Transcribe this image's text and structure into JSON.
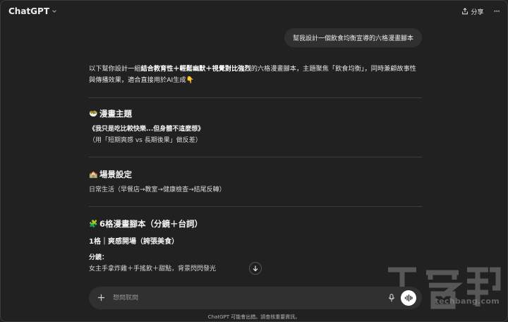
{
  "header": {
    "app_title": "ChatGPT",
    "share_label": "分享",
    "more_label": "···"
  },
  "user_message": "幫我設計一個飲食均衡宣導的六格漫畫腳本",
  "assistant": {
    "intro_1": "以下幫你設計一組",
    "intro_bold": "結合教育性＋輕鬆幽默＋視覺對比強烈",
    "intro_2": "的六格漫畫腳本，主題聚焦「飲食均衡」，同時兼顧故事性與傳播效果，適合直接用於AI生成",
    "intro_emoji": "👇",
    "sections": [
      {
        "emoji": "🥗",
        "title": "漫畫主題",
        "lines": [
          "《我只是吃比較快樂...但身體不這麼想》",
          "（用「短期爽感 vs 長期後果」做反差）"
        ]
      },
      {
        "emoji": "🏫",
        "title": "場景設定",
        "lines": [
          "日常生活（早餐店→教室→健康檢查→結尾反轉）"
        ]
      },
      {
        "emoji": "🧩",
        "title": "6格漫畫腳本（分鏡＋台詞）",
        "panel_title": "1格｜爽感開場（誇張美食）",
        "storyboard_label": "分鏡：",
        "storyboard_text": "女主手拿炸雞＋手搖飲＋甜點，背景閃閃發光"
      }
    ]
  },
  "composer": {
    "placeholder": "想問就問"
  },
  "disclaimer": "ChatGPT 可能會出錯。請查核重要資訊。",
  "watermark": {
    "logo_text": "T客邦",
    "url": "techbang.com"
  },
  "colors": {
    "background": "#212121",
    "bubble": "#303030",
    "divider": "#3b3b3b"
  }
}
